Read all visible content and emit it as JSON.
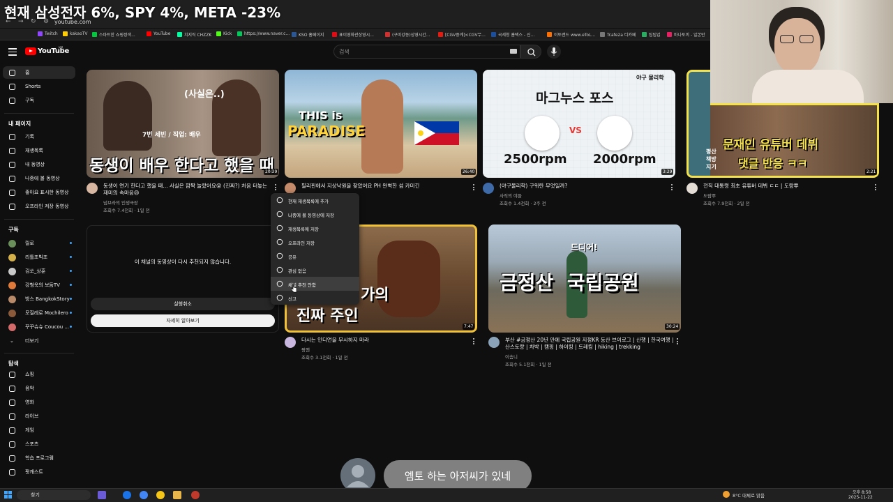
{
  "overlay": {
    "headline": "현재 삼성전자 6%, SPY 4%, META -23%",
    "caption": "엠토 하는 아저씨가 있네"
  },
  "browser": {
    "url": "youtube.com",
    "bookmarks": [
      "Twitch",
      "kakaoTV",
      "스마트한 쇼핑정색...",
      "YouTube",
      "치지직 CHZZK",
      "Kick",
      "https://www.naver.c...",
      "KSO 홈페이지",
      "표이영화관상영시...",
      "(구미강동)상영시간...",
      "[CGV중계]<CGV무...",
      "국세청 홈택스 - 신...",
      "이토랜드 www.eToL...",
      "Tcafe2a 티카페",
      "팁팁업",
      "마나토끼 - 일본만"
    ],
    "colors": {
      "bg": "#1f1f1f"
    }
  },
  "youtube": {
    "wordmark": "YouTube",
    "country": "KR",
    "search_placeholder": "검색",
    "sidebar": {
      "main": [
        {
          "label": "홈",
          "icon": "home-icon"
        },
        {
          "label": "Shorts",
          "icon": "shorts-icon"
        },
        {
          "label": "구독",
          "icon": "subscriptions-icon"
        }
      ],
      "you_heading": "내 페이지",
      "you": [
        {
          "label": "기록",
          "icon": "history-icon"
        },
        {
          "label": "재생목록",
          "icon": "playlist-icon"
        },
        {
          "label": "내 동영상",
          "icon": "my-videos-icon"
        },
        {
          "label": "나중에 볼 동영상",
          "icon": "watch-later-icon"
        },
        {
          "label": "좋아요 표시한 동영상",
          "icon": "like-icon"
        },
        {
          "label": "오프라인 저장 동영상",
          "icon": "download-icon"
        }
      ],
      "subs_heading": "구독",
      "subs": [
        {
          "label": "릴로",
          "color": "#6b8f5a"
        },
        {
          "label": "리틀조빅조",
          "color": "#d4b04a"
        },
        {
          "label": "김쏘_상훈",
          "color": "#c9c9c9"
        },
        {
          "label": "강형욱의 보듬TV",
          "color": "#e07a3b"
        },
        {
          "label": "방스 BangkokStory",
          "color": "#b88a6a"
        },
        {
          "label": "모질레로 Mochilero",
          "color": "#8a5a3b"
        },
        {
          "label": "꾸꾸슈슈 Coucou ...",
          "color": "#d46a6a"
        }
      ],
      "more": "더보기",
      "explore_heading": "탐색",
      "explore": [
        {
          "label": "쇼핑",
          "icon": "shopping-icon"
        },
        {
          "label": "음악",
          "icon": "music-icon"
        },
        {
          "label": "영화",
          "icon": "movie-icon"
        },
        {
          "label": "라이브",
          "icon": "live-icon"
        },
        {
          "label": "게임",
          "icon": "gaming-icon"
        },
        {
          "label": "스포츠",
          "icon": "sports-icon"
        },
        {
          "label": "학습 프로그램",
          "icon": "learning-icon"
        },
        {
          "label": "팟캐스트",
          "icon": "podcast-icon"
        }
      ]
    },
    "videos": [
      {
        "title": "동생이 연기 한다고 했을 때... 사실은 깜짝 놀랐어요😲 (진짜?) 처음 터놓는재미의 속마음😢",
        "channel": "넘브라의 인생극장",
        "meta": "조회수 7.4천회 · 1일 전",
        "duration": "20:39",
        "thumb_text": "동생이 배우 한다고 했을 때",
        "thumb_sub": "7번 세빈 / 직업: 배우",
        "thumb_bubble": "(사실은..)"
      },
      {
        "title": "필리핀에서 지상낙원을 찾았어요 PH 완벽한 섬 카미긴",
        "channel": "",
        "meta": "",
        "duration": "26:40",
        "thumb_text1": "THIS is",
        "thumb_text2": "PARADISE"
      },
      {
        "title": "(야구물리학) 구위란 무엇일까?",
        "channel": "사직의 야들",
        "meta": "조회수 1.4천회 · 2주 전",
        "duration": "3:29",
        "thumb_title": "마그누스 포스",
        "thumb_badge": "야구 물리학",
        "rpm_left": "2500rpm",
        "rpm_right": "2000rpm",
        "vs": "VS"
      },
      {
        "title": "전직 대통령 최초 유튜버 데뷔 ㄷㄷ | 도람뿌",
        "channel": "도람뿌",
        "meta": "조회수 7.9천회 · 2일 전",
        "duration": "2:21",
        "thumb_line1": "문재인 유튜버 데뷔",
        "thumb_line2": "댓글 반응 ㅋㅋ",
        "thumb_side": "평산 책방지기"
      },
      {
        "title": "다시는 인디언을 무시하지 마라",
        "channel": "짱깬",
        "meta": "조회수 3.1천회 · 1일 전",
        "duration": "7:47",
        "thumb_text1": "가의",
        "thumb_text2": "진짜 주인"
      },
      {
        "title": "부산 #금정산 20년 만에 국립공원 지정KR 등산 브이로그 | 산행 | 한국여행 | 산스토랑 | 차박 | 캠핑 | 하이킹 | 트레킹 | hiking | trekking",
        "channel": "이솜니",
        "meta": "조회수 5.1천회 · 1일 전",
        "duration": "30:24",
        "thumb_text": "금정산  국립공원",
        "thumb_bubble": "드디어!"
      }
    ],
    "not_interested": {
      "message": "이 채널의 동영상이 다시 추천되지 않습니다.",
      "undo": "실행취소",
      "learn_more": "자세히 알아보기"
    },
    "context_menu": [
      {
        "label": "현재 재생목록에 추가",
        "icon": "queue-icon"
      },
      {
        "label": "나중에 볼 동영상에 저장",
        "icon": "clock-icon"
      },
      {
        "label": "재생목록에 저장",
        "icon": "bookmark-icon"
      },
      {
        "label": "오프라인 저장",
        "icon": "download-icon"
      },
      {
        "label": "공유",
        "icon": "share-icon"
      },
      {
        "label": "관심 없음",
        "icon": "block-icon"
      },
      {
        "label": "채널 추천 안함",
        "icon": "minus-circle-icon"
      },
      {
        "label": "신고",
        "icon": "flag-icon"
      }
    ]
  },
  "taskbar": {
    "search": "찾기",
    "weather": "8°C 대체로 맑음",
    "time": "오후 8:58",
    "date": "2025-11-22"
  }
}
